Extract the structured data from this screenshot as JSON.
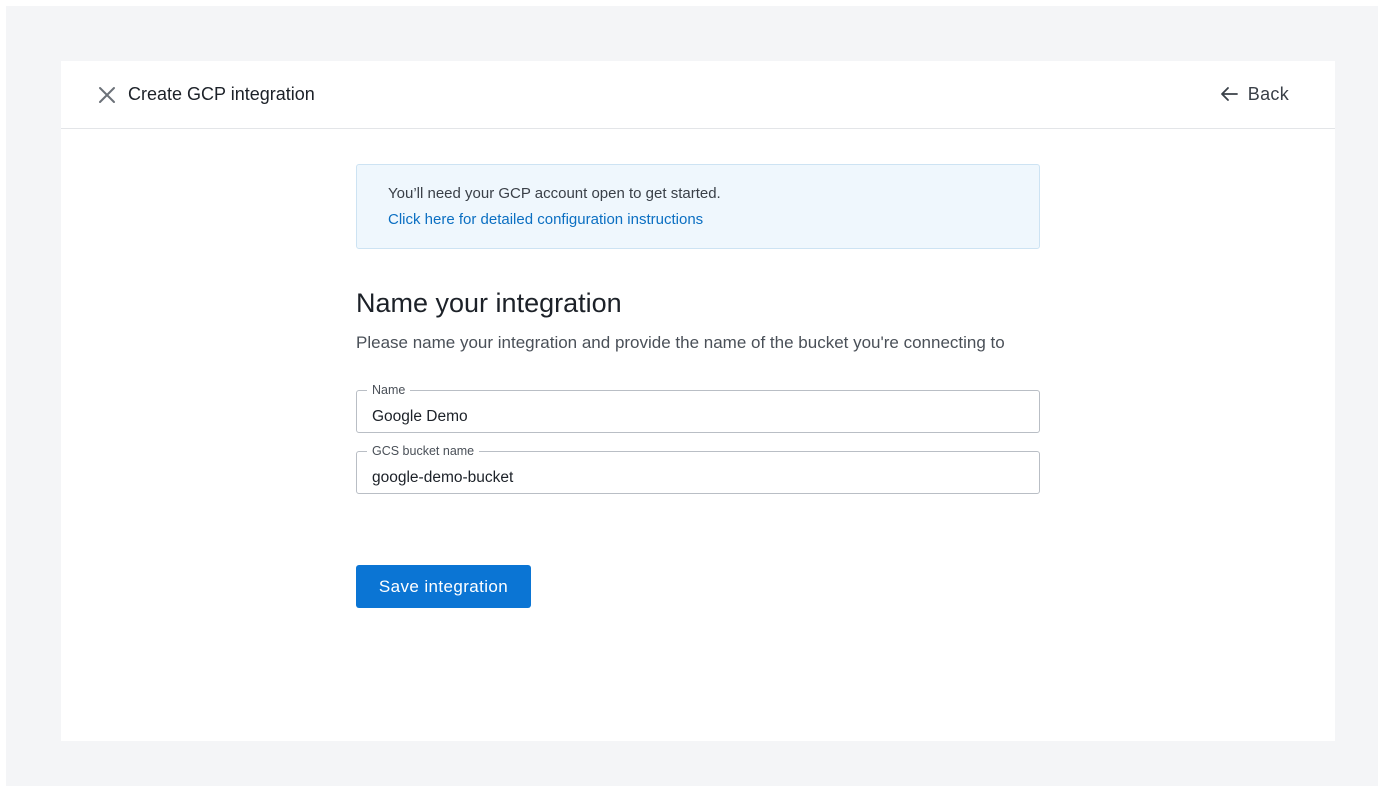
{
  "header": {
    "title": "Create GCP integration",
    "back_label": "Back",
    "close_icon": "close-icon",
    "back_icon": "arrow-left-icon"
  },
  "banner": {
    "text": "You’ll need your GCP account open to get started.",
    "link_text": "Click here for detailed configuration instructions"
  },
  "section": {
    "title": "Name your integration",
    "description": "Please name your integration and provide the name of the bucket you're connecting to"
  },
  "form": {
    "name_label": "Name",
    "name_value": "Google Demo",
    "bucket_label": "GCS bucket name",
    "bucket_value": "google-demo-bucket",
    "save_label": "Save integration"
  },
  "colors": {
    "accent": "#0b75d4",
    "link": "#0b6fc2",
    "banner_bg": "#eff7fd",
    "page_bg": "#f4f5f7"
  }
}
